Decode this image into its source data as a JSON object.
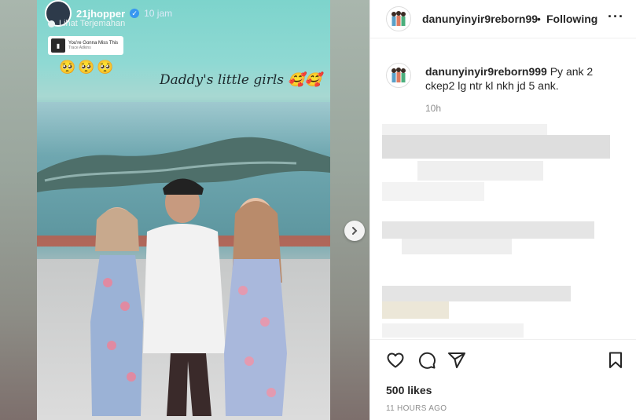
{
  "story": {
    "username": "21jhopper",
    "time": "10 jam",
    "translate": "Lihat Terjemahan",
    "music_title": "You're Gonna Miss This",
    "music_artist": "Trace Adkins",
    "emojis": "🥺🥺🥺",
    "caption": "Daddy's little girls",
    "caption_emojis": "🥰🥰"
  },
  "post": {
    "username": "danunyinyir9reborn999",
    "header_username": "danunyinyir9reborn99",
    "dot": "•",
    "follow_label": "Following",
    "more_icon": "more-icon",
    "caption": "Py ank 2 ckep2 lg ntr kl nkh jd 5 ank.",
    "time": "10h"
  },
  "actions": {
    "likes": "500 likes",
    "posted_ago": "11 HOURS AGO",
    "icons": [
      "heart-icon",
      "comment-icon",
      "share-icon",
      "bookmark-icon"
    ]
  },
  "colors": {
    "text": "#262626",
    "muted": "#8e8e8e",
    "border": "#efefef",
    "verified": "#3897f0"
  }
}
